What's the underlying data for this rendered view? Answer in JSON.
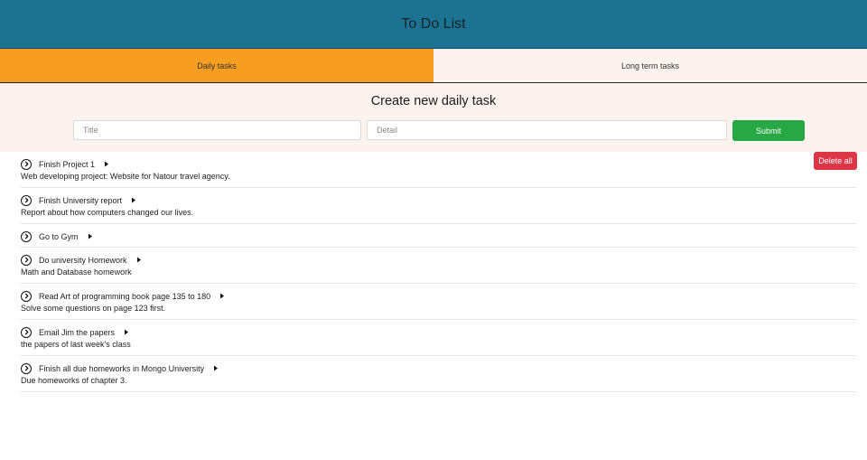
{
  "header": {
    "title": "To Do List"
  },
  "tabs": [
    {
      "label": "Daily tasks",
      "active": true
    },
    {
      "label": "Long term tasks",
      "active": false
    }
  ],
  "create": {
    "heading": "Create new daily task",
    "title_placeholder": "Title",
    "detail_placeholder": "Detail",
    "submit_label": "Submit"
  },
  "list": {
    "delete_all_label": "Delete all",
    "tasks": [
      {
        "title": "Finish Project 1",
        "detail": "Web developing project: Website for Natour travel agency."
      },
      {
        "title": "Finish University report",
        "detail": "Report about how computers changed our lives."
      },
      {
        "title": "Go to Gym",
        "detail": ""
      },
      {
        "title": "Do university Homework",
        "detail": "Math and Database homework"
      },
      {
        "title": "Read Art of programming book page 135 to 180",
        "detail": "Solve some questions on page 123 first."
      },
      {
        "title": "Email Jim the papers",
        "detail": "the papers of last week's class"
      },
      {
        "title": "Finish all due homeworks in Mongo University",
        "detail": "Due homeworks of chapter 3."
      }
    ]
  },
  "colors": {
    "header_bg": "#1b7391",
    "active_tab": "#f79d1f",
    "panel_bg": "#fcf2ee",
    "submit": "#28a745",
    "delete": "#dc3545"
  },
  "icons": {
    "task_toggle": "chevron-circle-right-icon",
    "task_expand": "caret-right-icon"
  }
}
